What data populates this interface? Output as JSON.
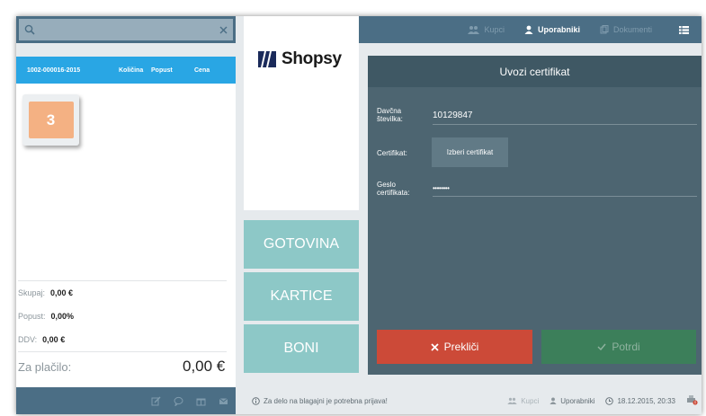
{
  "search": {
    "placeholder": ""
  },
  "cart": {
    "header": {
      "receipt_no": "1002-000016-2015",
      "col_qty": "Količina",
      "col_discount": "Popust",
      "col_price": "Cena"
    },
    "badge": "3",
    "totals": [
      {
        "label": "Skupaj:",
        "value": "0,00 €"
      },
      {
        "label": "Popust:",
        "value": "0,00%"
      },
      {
        "label": "DDV:",
        "value": "0,00 €"
      }
    ],
    "pay_label": "Za plačilo:",
    "pay_value": "0,00 €"
  },
  "logo": {
    "text": "Shopsy"
  },
  "payment_buttons": [
    "GOTOVINA",
    "KARTICE",
    "BONI"
  ],
  "topbar": {
    "customers": "Kupci",
    "users": "Uporabniki",
    "documents": "Dokumenti"
  },
  "certificate": {
    "title": "Uvozi certifikat",
    "tax_label": "Davčna številka:",
    "tax_value": "10129847",
    "cert_label": "Certifikat:",
    "pick_button": "Izberi certifikat",
    "password_label": "Geslo certifikata:",
    "password_value": "••••••••",
    "cancel": "Prekliči",
    "confirm": "Potrdi"
  },
  "status": {
    "message": "Za delo na blagajni je potrebna prijava!",
    "customers": "Kupci",
    "users": "Uporabniki",
    "datetime": "18.12.2015, 20:33"
  },
  "colors": {
    "accent_blue": "#29a6e4",
    "topbar": "#4b6e85",
    "panel": "#4d6571",
    "pay_teal": "#8dc8c7",
    "cancel_red": "#cc4a38",
    "confirm_green": "#3c7f5a",
    "badge_orange": "#f4b183"
  }
}
